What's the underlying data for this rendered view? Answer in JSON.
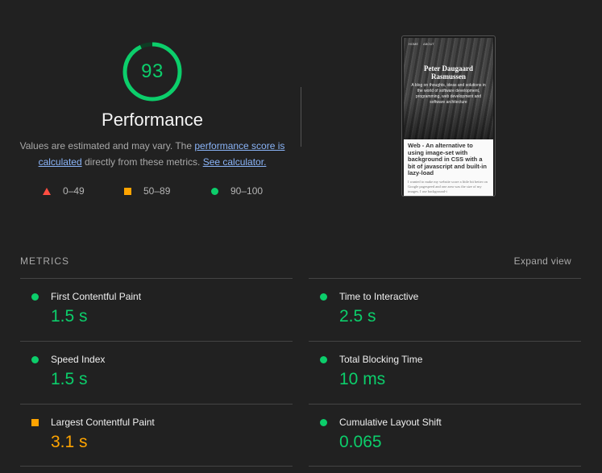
{
  "score": {
    "value": "93",
    "fraction": 0.93,
    "color": "#0cce6b",
    "category": "Performance"
  },
  "description": {
    "text_before": "Values are estimated and may vary. The ",
    "link_score": "performance score is calculated",
    "text_middle": " directly from these metrics. ",
    "link_calculator": "See calculator."
  },
  "legend": [
    {
      "shape": "triangle-icon",
      "range": "0–49",
      "color": "#ff4e42"
    },
    {
      "shape": "square-icon",
      "range": "50–89",
      "color": "#ffa400"
    },
    {
      "shape": "circle-icon",
      "range": "90–100",
      "color": "#0cce6b"
    }
  ],
  "screenshot": {
    "nav": [
      "HOME",
      "ABOUT"
    ],
    "site_title": "Peter Daugaard Rasmussen",
    "site_subtitle": "A blog on thoughts, ideas and solutions in the world of software development, programming, web development and software architecture",
    "post_title": "Web - An alternative to using image-set with background in CSS with a bit of javascript and built-in lazy-load",
    "post_excerpt": "I wanted to make my website score a little bit better on Google pagespeed and one area was the size of my images. I use background-i"
  },
  "metrics_section": {
    "title": "METRICS",
    "expand": "Expand view"
  },
  "metrics": [
    {
      "name": "First Contentful Paint",
      "value": "1.5 s",
      "status": "pass"
    },
    {
      "name": "Time to Interactive",
      "value": "2.5 s",
      "status": "pass"
    },
    {
      "name": "Speed Index",
      "value": "1.5 s",
      "status": "pass"
    },
    {
      "name": "Total Blocking Time",
      "value": "10 ms",
      "status": "pass"
    },
    {
      "name": "Largest Contentful Paint",
      "value": "3.1 s",
      "status": "average"
    },
    {
      "name": "Cumulative Layout Shift",
      "value": "0.065",
      "status": "pass"
    }
  ]
}
